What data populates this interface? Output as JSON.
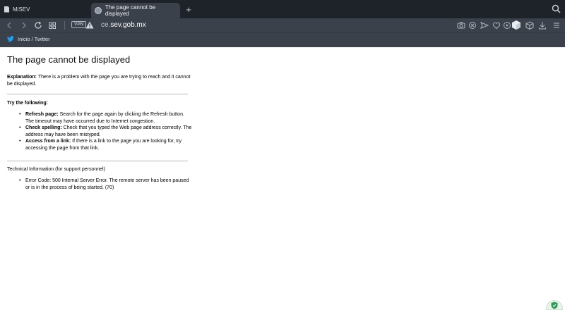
{
  "tabs": [
    {
      "title": "MiSEV",
      "active": false
    },
    {
      "title": "The page cannot be displayed",
      "active": true
    }
  ],
  "new_tab_label": "+",
  "toolbar": {
    "vpn_label": "VPN",
    "url_prefix": "ce.",
    "url_domain": "sev.gob.mx"
  },
  "bookmarks": [
    {
      "label": "Inicio / Twitter",
      "icon": "twitter-icon"
    }
  ],
  "page": {
    "title": "The page cannot be displayed",
    "explanation_label": "Explanation:",
    "explanation_text": " There is a problem with the page you are trying to reach and it cannot be displayed.",
    "try_heading": "Try the following:",
    "suggestions": [
      {
        "label": "Refresh page:",
        "text": " Search for the page again by clicking the Refresh button. The timeout may have occurred due to Internet congestion."
      },
      {
        "label": "Check spelling:",
        "text": " Check that you typed the Web page address correctly. The address may have been mistyped."
      },
      {
        "label": "Access from a link:",
        "text": " If there is a link to the page you are looking for, try accessing the page from that link."
      }
    ],
    "tech_heading": "Technical Information (for support personnel)",
    "error_text": "Error Code: 500 Internal Server Error. The remote server has been paused or is in the process of being started. (70)"
  },
  "colors": {
    "tabbar_bg": "#1e2329",
    "toolbar_bg": "#3a414a",
    "twitter_blue": "#1da1f2",
    "shield_green": "#2e9b55"
  }
}
